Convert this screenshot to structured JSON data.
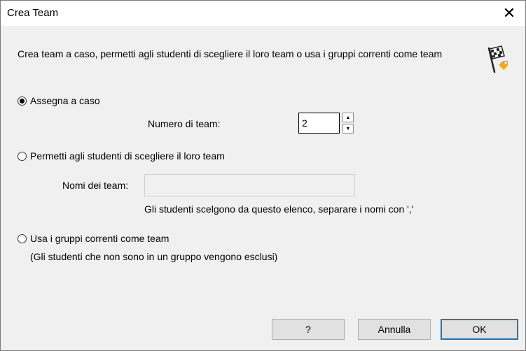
{
  "window": {
    "title": "Crea Team",
    "close_glyph": "✕"
  },
  "description": "Crea team a caso, permetti agli studenti di scegliere il loro team o usa i gruppi correnti come team",
  "icon": {
    "name": "checkered-flag-tag-icon",
    "accent": "#f5a623"
  },
  "options": {
    "random": {
      "label": "Assegna a caso",
      "selected": true
    },
    "choose": {
      "label": "Permetti agli studenti di scegliere il loro team",
      "selected": false
    },
    "groups": {
      "label": "Usa i gruppi correnti come team",
      "selected": false
    }
  },
  "team_count": {
    "label": "Numero di team:",
    "value": "2",
    "up_glyph": "▲",
    "down_glyph": "▼"
  },
  "team_names": {
    "label": "Nomi dei team:",
    "value": "",
    "hint": "Gli studenti scelgono da questo elenco, separare i nomi con ','"
  },
  "groups_note": "(Gli studenti che non sono in un gruppo vengono esclusi)",
  "buttons": {
    "help": "?",
    "cancel": "Annulla",
    "ok": "OK"
  },
  "colors": {
    "dialog_bg": "#f0f0f0",
    "default_button_border": "#0078d7"
  }
}
